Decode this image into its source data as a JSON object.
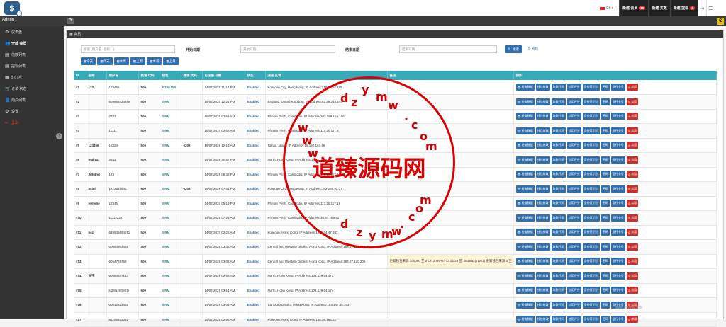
{
  "header": {
    "logo_glyph": "$",
    "language": "Ch",
    "new_member_label": "新建 会员",
    "new_member_count": "15",
    "new_deposit_label": "新建 买数",
    "new_withdraw_label": "新建 提现",
    "new_withdraw_count": "1",
    "app_name": "Admin"
  },
  "sidebar": {
    "items": [
      {
        "icon": "dashboard-icon",
        "glyph": "⚙",
        "label": "仪表盘"
      },
      {
        "icon": "users-icon",
        "glyph": "👥",
        "label": "全部 会员"
      },
      {
        "icon": "deposit-icon",
        "glyph": "▤",
        "label": "借款列表"
      },
      {
        "icon": "withdraw-icon",
        "glyph": "▤",
        "label": "提现列表"
      },
      {
        "icon": "slides-icon",
        "glyph": "▦",
        "label": "幻灯片"
      },
      {
        "icon": "cart-icon",
        "glyph": "🛒",
        "label": "订单 状态"
      },
      {
        "icon": "user-icon",
        "glyph": "👤",
        "label": "用户列表"
      },
      {
        "icon": "settings-icon",
        "glyph": "⚙",
        "label": "设置"
      },
      {
        "icon": "logout-icon",
        "glyph": "↩",
        "label": "登出"
      }
    ]
  },
  "panel": {
    "title": "会员",
    "search_placeholder": "搜索 (用户名, 名称, ..)",
    "start_date_label": "开始日期",
    "start_date_placeholder": "开始日期",
    "end_date_label": "结束日期",
    "end_date_placeholder": "结束日期",
    "search_button": "搜索",
    "reset_link": "刷新",
    "ranges": [
      "今天",
      "昨天",
      "本周",
      "上周",
      "本月",
      "上月"
    ]
  },
  "table": {
    "columns": [
      "ID",
      "名称",
      "用户名",
      "提现 代码",
      "钱包",
      "提现 代码",
      "已注册 日期",
      "状态",
      "注册 区域",
      "备注",
      "操作"
    ],
    "actions": [
      "检查数据",
      "钱包修改",
      "取款代码",
      "信用评分",
      "身份证识别",
      "密码",
      "银行卡号",
      "禁用"
    ],
    "rows": [
      {
        "id": "#1",
        "name": "123",
        "user": "123456",
        "code": "500",
        "wallet": "8,766 RM",
        "wcode": "",
        "date": "14/07/2025 11:17 PM",
        "status": "Enabled",
        "region": "Kowloon City, Hong Kong, IP Address:219.73.92.115",
        "note": ""
      },
      {
        "id": "#2",
        "name": "",
        "user": "609668434268",
        "code": "500",
        "wallet": "0 RM",
        "wcode": "",
        "date": "15/07/2025 12:21 PM",
        "status": "Enabled",
        "region": "England, United Kingdom, IP Address:82.29.214.244",
        "note": ""
      },
      {
        "id": "#3",
        "name": "",
        "user": "2333",
        "code": "500",
        "wallet": "0 RM",
        "wcode": "",
        "date": "15/07/2025 07:59 AM",
        "status": "Enabled",
        "region": "Phnom Penh, Cambodia, IP Address:203.189.154.196",
        "note": ""
      },
      {
        "id": "#4",
        "name": "",
        "user": "11111",
        "code": "500",
        "wallet": "0 RM",
        "wcode": "",
        "date": "15/07/2025 02:59 AM",
        "status": "Enabled",
        "region": "Phnom Penh, Cambodia, IP Address:117.20.117.8",
        "note": ""
      },
      {
        "id": "#5",
        "name": "123456",
        "user": "12323",
        "code": "500",
        "wallet": "0 RM",
        "wcode": "0202",
        "date": "15/07/2025 12:13 AM",
        "status": "Enabled",
        "region": "Tokyo, Japan, IP Address:18.182.103.46",
        "note": ""
      },
      {
        "id": "#6",
        "name": "maliya",
        "user": "3543",
        "code": "500",
        "wallet": "0 RM",
        "wcode": "",
        "date": "14/07/2025 10:57 PM",
        "status": "Enabled",
        "region": "North, Hong Kong, IP Address:103.129.54.174",
        "note": ""
      },
      {
        "id": "#7",
        "name": "Jdhdhd",
        "user": "123",
        "code": "500",
        "wallet": "0 RM",
        "wcode": "",
        "date": "14/07/2025 06:38 PM",
        "status": "Enabled",
        "region": "Phnom Penh, Cambodia, IP Address:117.20.117.16",
        "note": ""
      },
      {
        "id": "#8",
        "name": "asad",
        "user": "1212545545",
        "code": "500",
        "wallet": "0 RM",
        "wcode": "0203",
        "date": "14/07/2025 07:31 PM",
        "status": "Enabled",
        "region": "Kowloon City, Hong Kong, IP Address:182.239.92.37",
        "note": ""
      },
      {
        "id": "#9",
        "name": "Hehehe",
        "user": "12345",
        "code": "500",
        "wallet": "0 RM",
        "wcode": "",
        "date": "14/07/2025 05:19 PM",
        "status": "Enabled",
        "region": "Phnom Penh, Cambodia, IP Address:117.20.117.16",
        "note": ""
      },
      {
        "id": "#10",
        "name": "",
        "user": "11112222",
        "code": "500",
        "wallet": "0 RM",
        "wcode": "",
        "date": "14/07/2025 07:23 AM",
        "status": "Enabled",
        "region": "Phnom Penh, Cambodia, IP Address:36.37.189.41",
        "note": ""
      },
      {
        "id": "#11",
        "name": "hez",
        "user": "639935694211",
        "code": "500",
        "wallet": "0 RM",
        "wcode": "",
        "date": "14/07/2025 02:28 AM",
        "status": "Enabled",
        "region": "Kowloon, Hong Kong, IP Address:165.154.47.202",
        "note": ""
      },
      {
        "id": "#12",
        "name": "",
        "user": "60654563465",
        "code": "500",
        "wallet": "0 RM",
        "wcode": "",
        "date": "14/07/2025 03:36 AM",
        "status": "Enabled",
        "region": "Central and Western District, Hong Kong, IP Address:183.87.120.206",
        "note": ""
      },
      {
        "id": "#13",
        "name": "",
        "user": "6054765768",
        "code": "500",
        "wallet": "0 RM",
        "wcode": "",
        "date": "14/07/2025 03:08 AM",
        "status": "Enabled",
        "region": "Central and Western District, Hong Kong, IP Address:183.87.120.206",
        "note": "更新钱包来源 100000 至 0 On 2025-07-13 22:25 签: ba28a2(trt921) 更新钱包来源 0 至 100000 On 2025-07-13 22:24 签: ba28a2(trt921)"
      },
      {
        "id": "#14",
        "name": "佐宇",
        "user": "60684847123",
        "code": "500",
        "wallet": "0 RM",
        "wcode": "",
        "date": "14/07/2025 02:59 AM",
        "status": "Enabled",
        "region": "North, Hong Kong, IP Address:103.129.54.173",
        "note": ""
      },
      {
        "id": "#15",
        "name": "",
        "user": "sj28la2(trt921)",
        "code": "500",
        "wallet": "0 RM",
        "wcode": "",
        "date": "14/07/2025 03:14 AM",
        "status": "Enabled",
        "region": "North, Hong Kong, IP Address:103.129.54.174",
        "note": ""
      },
      {
        "id": "#16",
        "name": "",
        "user": "60012623492",
        "code": "500",
        "wallet": "0 RM",
        "wcode": "",
        "date": "14/07/2025 03:03 AM",
        "status": "Enabled",
        "region": "Sai Kung District, Hong Kong, IP Address:103.147.45.163",
        "note": ""
      },
      {
        "id": "#17",
        "name": "",
        "user": "63195463021",
        "code": "500",
        "wallet": "0 RM",
        "wcode": "",
        "date": "14/07/2025 02:56 AM",
        "status": "Enabled",
        "region": "Kowloon, Hong Kong, IP Address:185.36.195.22",
        "note": ""
      }
    ]
  },
  "watermark": {
    "title": "道臻源码网",
    "chars_top": [
      "d",
      "z",
      "y",
      "m",
      "w",
      ".",
      "c",
      "o",
      "m"
    ],
    "chars_left": [
      "w",
      "w",
      "w"
    ],
    "chars_bottom": [
      "d",
      "z",
      "y",
      "m",
      "w",
      ".",
      "c",
      "o",
      "m"
    ],
    "link_text": "www.dzymw.com"
  }
}
